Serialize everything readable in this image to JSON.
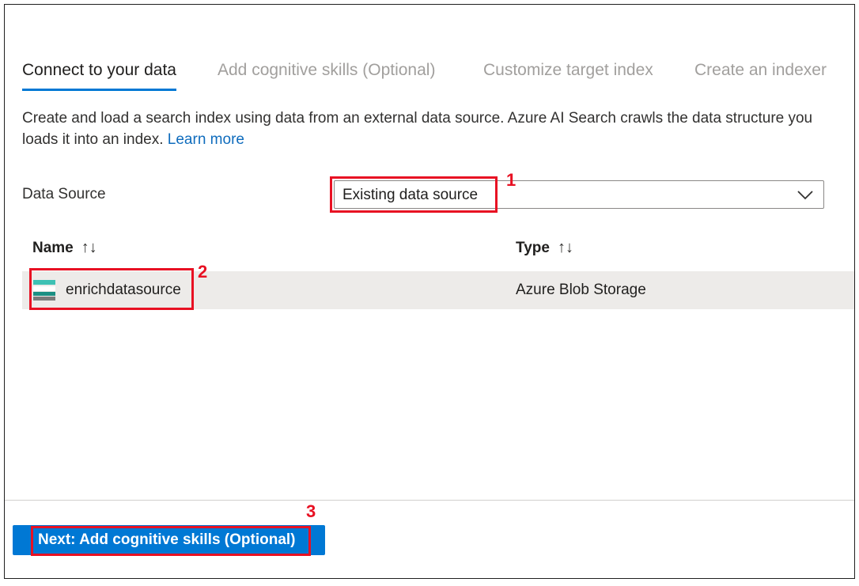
{
  "tabs": [
    {
      "label": "Connect to your data",
      "active": true
    },
    {
      "label": "Add cognitive skills (Optional)",
      "active": false
    },
    {
      "label": "Customize target index",
      "active": false
    },
    {
      "label": "Create an indexer",
      "active": false
    }
  ],
  "description": {
    "line1": "Create and load a search index using data from an external data source. Azure AI Search crawls the data structure you",
    "line2": "loads it into an index.",
    "learn_more": "Learn more"
  },
  "data_source": {
    "label": "Data Source",
    "selected": "Existing data source"
  },
  "table": {
    "columns": [
      "Name",
      "Type"
    ],
    "sort_icon": "↑↓",
    "rows": [
      {
        "name": "enrichdatasource",
        "type": "Azure Blob Storage",
        "icon": "storage-icon"
      }
    ]
  },
  "footer": {
    "next_label": "Next: Add cognitive skills (Optional)"
  },
  "annotations": [
    "1",
    "2",
    "3"
  ],
  "colors": {
    "accent": "#0078d4",
    "highlight": "#e81123",
    "selected_row": "#edebe9"
  }
}
